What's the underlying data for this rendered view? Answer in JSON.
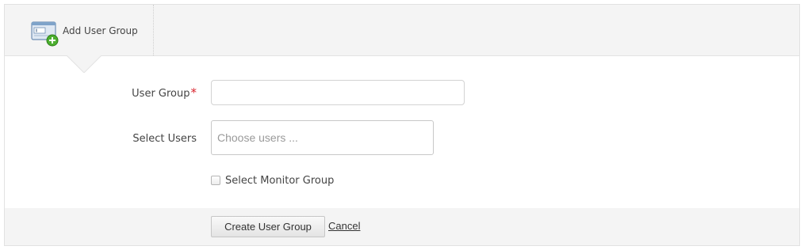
{
  "header": {
    "tab_label": "Add User Group",
    "tab_icon": "add-user-group-icon"
  },
  "form": {
    "user_group": {
      "label": "User Group",
      "required_marker": "*",
      "value": "",
      "placeholder": ""
    },
    "select_users": {
      "label": "Select Users",
      "value": "",
      "placeholder": "Choose users ..."
    },
    "monitor_group": {
      "label": "Select Monitor Group",
      "checked": false
    }
  },
  "footer": {
    "create_label": "Create User Group",
    "cancel_label": "Cancel"
  },
  "colors": {
    "required": "#d9232d",
    "header_bg": "#f4f4f4",
    "icon_green": "#4caf2f"
  }
}
